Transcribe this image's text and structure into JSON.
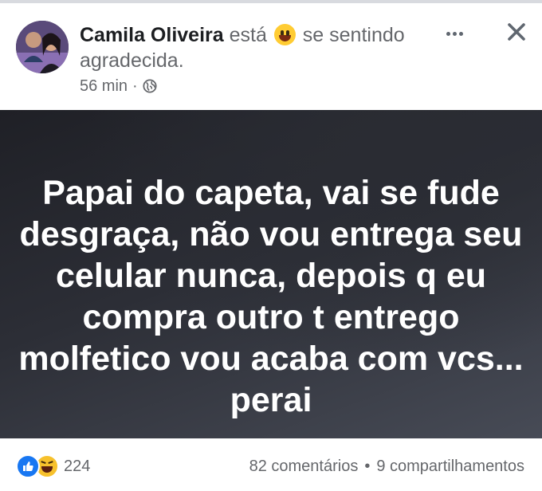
{
  "post": {
    "author": "Camila Oliveira",
    "feeling_prefix": "está",
    "feeling_emoji": "smiley-emoji",
    "feeling_text": "se sentindo agradecida.",
    "time": "56 min",
    "separator": "·",
    "audience_icon": "globe-icon",
    "body": "Papai do capeta, vai se fude desgraça, não vou entrega seu celular nunca, depois q eu compra outro t entrego molfetico vou acaba com vcs... perai",
    "background": "dark-gradient"
  },
  "header": {
    "more_icon": "more-horizontal-icon",
    "close_icon": "close-icon"
  },
  "footer": {
    "reaction_icons": [
      "like-icon",
      "haha-icon"
    ],
    "reaction_count": "224",
    "comments": "82 comentários",
    "separator": "•",
    "shares": "9 compartilhamentos"
  },
  "colors": {
    "accent": "#1877f2",
    "secondary_text": "#65676b",
    "primary_text": "#1c1e21"
  }
}
